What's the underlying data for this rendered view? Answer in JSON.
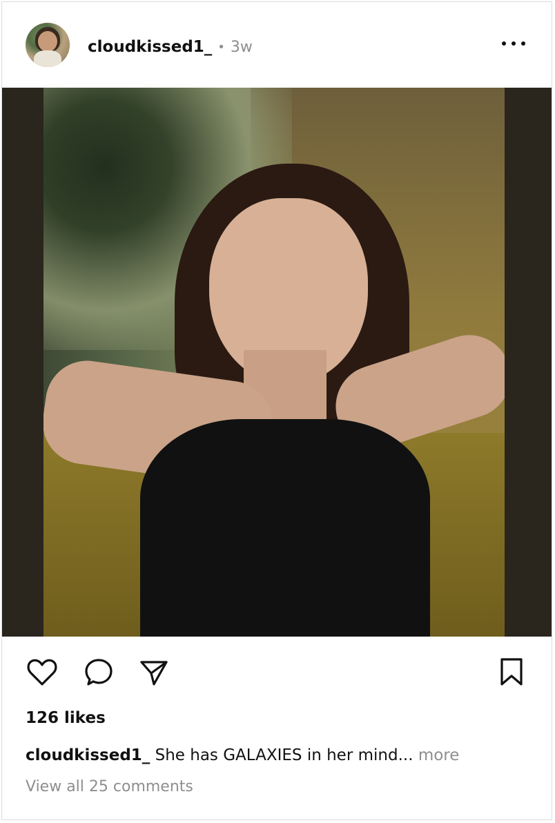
{
  "post": {
    "username": "cloudkissed1_",
    "separator": "•",
    "time_ago": "3w",
    "likes_text": "126 likes",
    "caption": {
      "username": "cloudkissed1_",
      "text": "She has GALAXIES in her mind...",
      "more_label": "more"
    },
    "comments_text": "View all 25 comments"
  },
  "icons": {
    "more": "more-horizontal-icon",
    "like": "heart-icon",
    "comment": "comment-icon",
    "share": "send-icon",
    "save": "bookmark-icon"
  },
  "colors": {
    "text_primary": "#111111",
    "text_secondary": "#8e8e8e",
    "border": "#dbdbdb",
    "background": "#ffffff"
  }
}
